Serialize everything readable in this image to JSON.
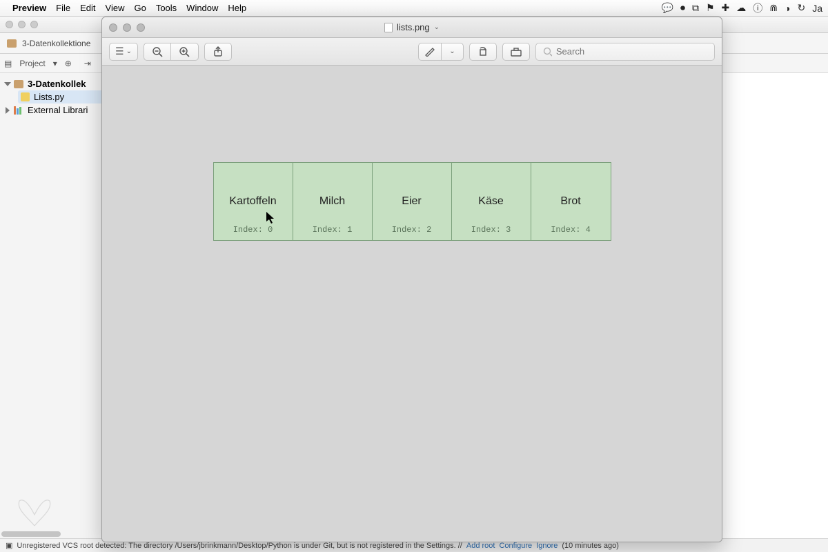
{
  "menubar": {
    "app": "Preview",
    "items": [
      "File",
      "Edit",
      "View",
      "Go",
      "Tools",
      "Window",
      "Help"
    ],
    "right_label": "Ja"
  },
  "ide": {
    "breadcrumb": "3-Datenkollektione",
    "project_label": "Project",
    "tree": {
      "root": "3-Datenkollek",
      "file": "Lists.py",
      "lib": "External Librari"
    },
    "status_prefix": "Unregistered VCS root detected: The directory /Users/jbrinkmann/Desktop/Python is under Git, but is not registered in the Settings. //",
    "status_addroot": "Add root",
    "status_configure": "Configure",
    "status_ignore": "Ignore",
    "status_time": "(10 minutes ago)"
  },
  "preview": {
    "title": "lists.png",
    "search_placeholder": "Search"
  },
  "list_items": [
    {
      "word": "Kartoffeln",
      "index": "Index: 0"
    },
    {
      "word": "Milch",
      "index": "Index: 1"
    },
    {
      "word": "Eier",
      "index": "Index: 2"
    },
    {
      "word": "Käse",
      "index": "Index: 3"
    },
    {
      "word": "Brot",
      "index": "Index: 4"
    }
  ]
}
